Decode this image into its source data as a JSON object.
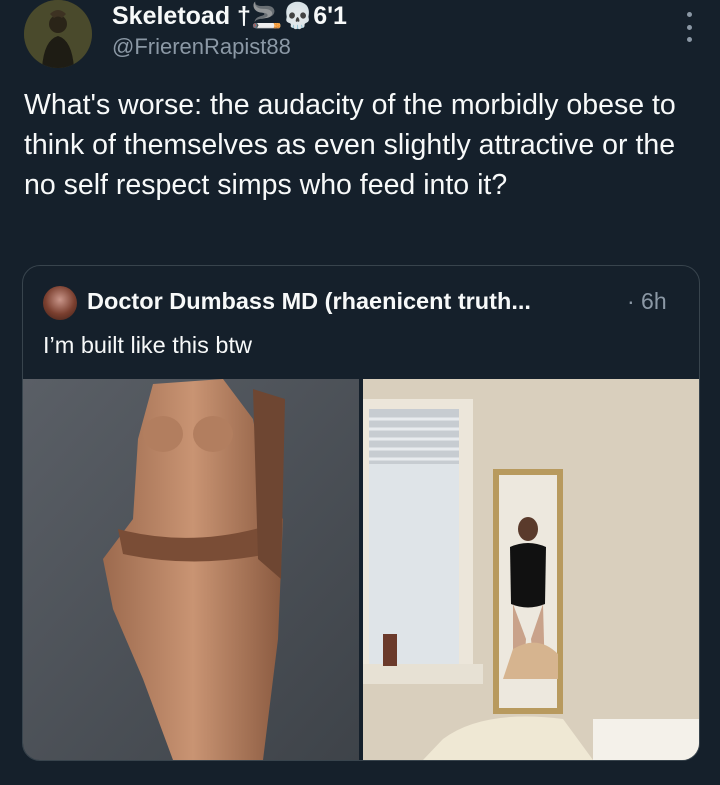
{
  "tweet": {
    "author_name": "Skeletoad †🚬💀6'1",
    "author_handle": "@FrierenRapist88",
    "text": "What's worse: the audacity of the morbidly obese to think of themselves as even slightly attractive or the no self respect simps who feed into it?"
  },
  "quote": {
    "author_name": "Doctor Dumbass MD (rhaenicent truth...",
    "time": "· 6h",
    "text": "I’m built like this btw"
  },
  "icons": {
    "more": "more-vertical-icon"
  },
  "colors": {
    "background": "#15202b",
    "text_primary": "#f7f9f9",
    "text_secondary": "#8b98a5",
    "border": "#38444d"
  }
}
